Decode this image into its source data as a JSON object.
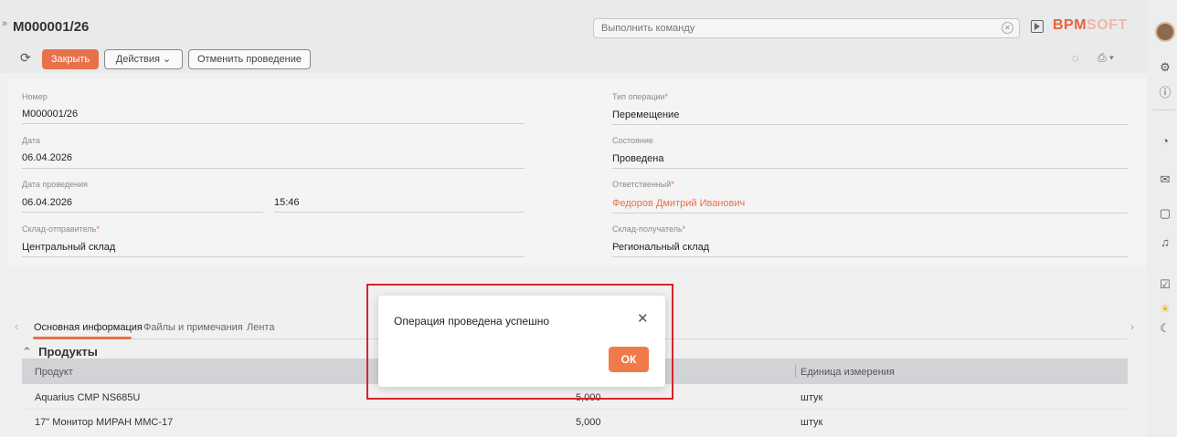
{
  "header": {
    "title": "М000001/26",
    "command_placeholder": "Выполнить команду",
    "logo_part1": "BPM",
    "logo_part2": "SOFT"
  },
  "toolbar": {
    "close_label": "Закрыть",
    "actions_label": "Действия",
    "cancel_posting_label": "Отменить проведение"
  },
  "form": {
    "number_label": "Номер",
    "number_value": "М000001/26",
    "operation_type_label": "Тип операции",
    "operation_type_value": "Перемещение",
    "date_label": "Дата",
    "date_value": "06.04.2026",
    "state_label": "Состояние",
    "state_value": "Проведена",
    "posting_date_label": "Дата проведения",
    "posting_date_value": "06.04.2026",
    "posting_time_value": "15:46",
    "responsible_label": "Ответственный",
    "responsible_value": "Федоров Дмитрий Иванович",
    "sender_label": "Склад-отправитель",
    "sender_value": "Центральный склад",
    "receiver_label": "Склад-получатель",
    "receiver_value": "Региональный склад",
    "required_mark": "*"
  },
  "tabs": [
    {
      "label": "Основная информация"
    },
    {
      "label": "Файлы и примечания"
    },
    {
      "label": "Лента"
    }
  ],
  "products": {
    "section_title": "Продукты",
    "columns": [
      "Продукт",
      "Единица измерения"
    ],
    "rows": [
      {
        "product": "Aquarius CMP NS685U",
        "qty": "5,000",
        "unit": "штук"
      },
      {
        "product": "17\" Монитор МИРАН ММС-17",
        "qty": "5,000",
        "unit": "штук"
      }
    ]
  },
  "modal": {
    "message": "Операция проведена успешно",
    "ok_label": "ОК"
  },
  "colors": {
    "accent": "#e8714a",
    "highlight_border": "#d6242a"
  }
}
